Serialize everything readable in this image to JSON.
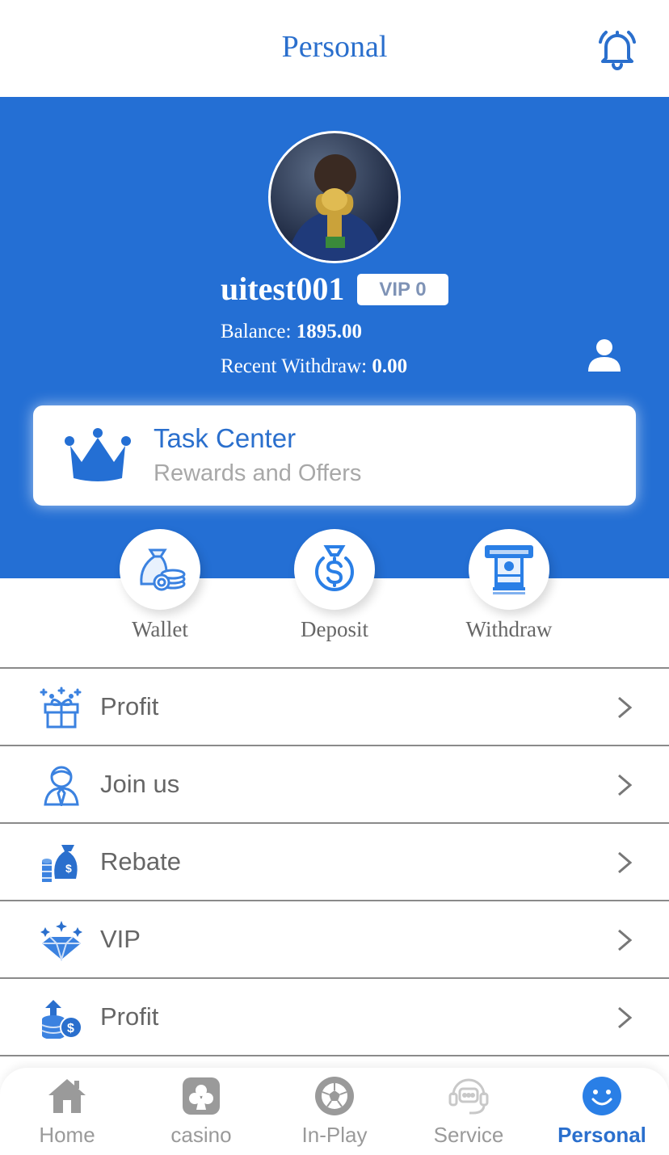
{
  "header": {
    "title": "Personal",
    "bell_icon": "bell-icon"
  },
  "profile": {
    "username": "uitest001",
    "vip_badge": "VIP 0",
    "balance_label": "Balance:",
    "balance_value": "1895.00",
    "withdraw_label": "Recent Withdraw:",
    "withdraw_value": "0.00",
    "profile_icon": "user-icon"
  },
  "task_center": {
    "title": "Task Center",
    "subtitle": "Rewards and Offers",
    "icon": "crown-icon"
  },
  "quick_actions": [
    {
      "label": "Wallet",
      "icon": "money-bag-coins-icon"
    },
    {
      "label": "Deposit",
      "icon": "dollar-bag-icon"
    },
    {
      "label": "Withdraw",
      "icon": "atm-cash-icon"
    }
  ],
  "menu": [
    {
      "label": "Profit",
      "icon": "gift-icon"
    },
    {
      "label": "Join us",
      "icon": "agent-icon"
    },
    {
      "label": "Rebate",
      "icon": "money-bag-stack-icon"
    },
    {
      "label": "VIP",
      "icon": "diamond-icon"
    },
    {
      "label": "Profit",
      "icon": "coins-up-icon"
    }
  ],
  "tabs": [
    {
      "label": "Home",
      "icon": "home-icon",
      "active": false
    },
    {
      "label": "casino",
      "icon": "cards-icon",
      "active": false
    },
    {
      "label": "In-Play",
      "icon": "soccer-ball-icon",
      "active": false
    },
    {
      "label": "Service",
      "icon": "headset-chat-icon",
      "active": false
    },
    {
      "label": "Personal",
      "icon": "smiley-icon",
      "active": true
    }
  ],
  "colors": {
    "primary": "#246fd4",
    "accent_text": "#2a6fcd",
    "muted_text": "#666666",
    "inactive_tab": "#9a9a9a"
  }
}
